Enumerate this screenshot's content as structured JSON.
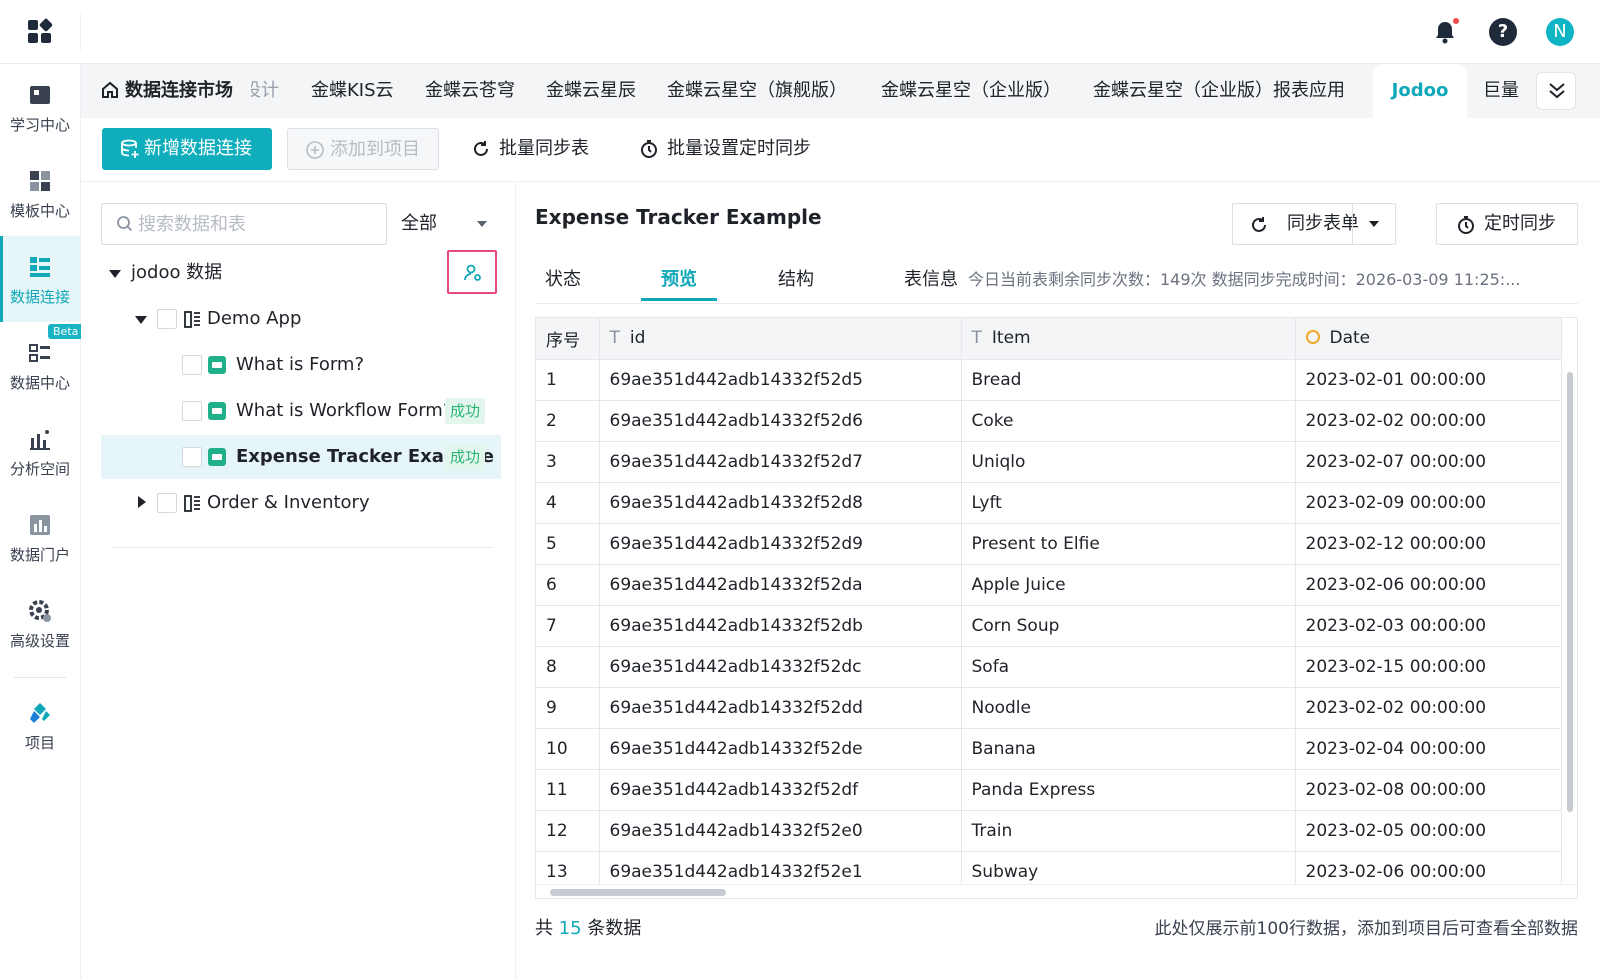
{
  "sidebar": {
    "items": [
      {
        "label": "学习中心",
        "icon": "book-icon"
      },
      {
        "label": "模板中心",
        "icon": "template-icon"
      },
      {
        "label": "数据连接",
        "icon": "data-connect-icon",
        "active": true
      },
      {
        "label": "数据中心",
        "icon": "data-center-icon",
        "badge": "Beta"
      },
      {
        "label": "分析空间",
        "icon": "analysis-icon"
      },
      {
        "label": "数据门户",
        "icon": "portal-icon"
      },
      {
        "label": "高级设置",
        "icon": "gear-icon"
      },
      {
        "label": "项目",
        "icon": "project-icon"
      }
    ]
  },
  "header": {
    "avatar_initial": "N",
    "help_glyph": "?"
  },
  "tabs": {
    "home": "数据连接市场",
    "items": [
      "设计",
      "金蝶KIS云",
      "金蝶云苍穹",
      "金蝶云星辰",
      "金蝶云星空（旗舰版）",
      "金蝶云星空（企业版）",
      "金蝶云星空（企业版）报表应用",
      "Jodoo",
      "巨量"
    ],
    "active": "Jodoo"
  },
  "toolbar": {
    "new_connection": "新增数据连接",
    "add_to_project": "添加到项目",
    "batch_sync": "批量同步表",
    "batch_timer": "批量设置定时同步"
  },
  "tree": {
    "search_placeholder": "搜索数据和表",
    "filter_value": "全部",
    "root": "jodoo 数据",
    "app1": "Demo App",
    "form1": "What is Form?",
    "form2": "What is Workflow Form?",
    "form3": "Expense Tracker Example",
    "success_label": "成功",
    "app2": "Order & Inventory"
  },
  "detail": {
    "title": "Expense Tracker Example",
    "sync_form": "同步表单",
    "timer_sync": "定时同步",
    "tabs": [
      "状态",
      "预览",
      "结构"
    ],
    "active_tab": "预览",
    "info_label": "表信息",
    "info_text": "今日当前表剩余同步次数：149次   数据同步完成时间：2026-03-09 11:25:..."
  },
  "table": {
    "columns": [
      "序号",
      "id",
      "Item",
      "Date"
    ],
    "rows": [
      [
        "1",
        "69ae351d442adb14332f52d5",
        "Bread",
        "2023-02-01 00:00:00"
      ],
      [
        "2",
        "69ae351d442adb14332f52d6",
        "Coke",
        "2023-02-02 00:00:00"
      ],
      [
        "3",
        "69ae351d442adb14332f52d7",
        "Uniqlo",
        "2023-02-07 00:00:00"
      ],
      [
        "4",
        "69ae351d442adb14332f52d8",
        "Lyft",
        "2023-02-09 00:00:00"
      ],
      [
        "5",
        "69ae351d442adb14332f52d9",
        "Present to Elfie",
        "2023-02-12 00:00:00"
      ],
      [
        "6",
        "69ae351d442adb14332f52da",
        "Apple Juice",
        "2023-02-06 00:00:00"
      ],
      [
        "7",
        "69ae351d442adb14332f52db",
        "Corn Soup",
        "2023-02-03 00:00:00"
      ],
      [
        "8",
        "69ae351d442adb14332f52dc",
        "Sofa",
        "2023-02-15 00:00:00"
      ],
      [
        "9",
        "69ae351d442adb14332f52dd",
        "Noodle",
        "2023-02-02 00:00:00"
      ],
      [
        "10",
        "69ae351d442adb14332f52de",
        "Banana",
        "2023-02-04 00:00:00"
      ],
      [
        "11",
        "69ae351d442adb14332f52df",
        "Panda Express",
        "2023-02-08 00:00:00"
      ],
      [
        "12",
        "69ae351d442adb14332f52e0",
        "Train",
        "2023-02-05 00:00:00"
      ],
      [
        "13",
        "69ae351d442adb14332f52e1",
        "Subway",
        "2023-02-06 00:00:00"
      ]
    ]
  },
  "footer": {
    "count_prefix": "共",
    "count": "15",
    "count_suffix": "条数据",
    "note": "此处仅展示前100行数据，添加到项目后可查看全部数据"
  },
  "colors": {
    "accent": "#10aebc",
    "success": "#2bb673",
    "highlight_border": "#e84a7a"
  }
}
